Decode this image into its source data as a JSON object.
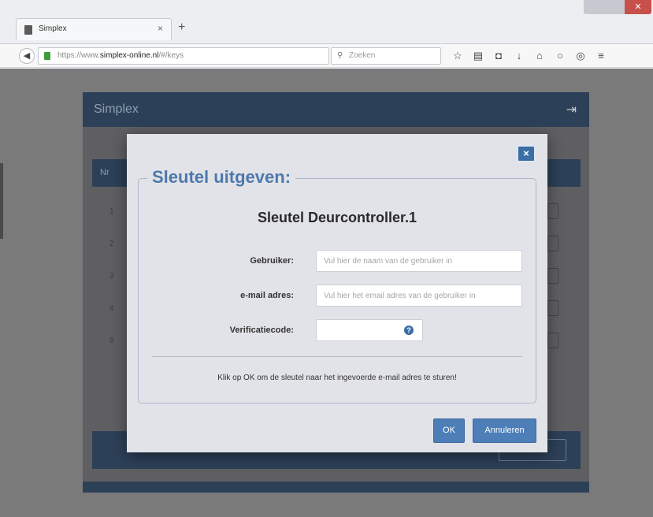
{
  "browser": {
    "tab_title": "Simplex",
    "tab_close": "×",
    "new_tab": "+",
    "window_close": "✕",
    "url_prefix": "https://www.",
    "url_domain": "simplex-online.nl",
    "url_path": "/#/keys",
    "search_placeholder": "Zoeken",
    "icons": [
      "back-icon",
      "lock-icon",
      "reload-icon",
      "search-icon",
      "bookmark-star-icon",
      "reading-list-icon",
      "pocket-icon",
      "download-icon",
      "home-icon",
      "chat-icon",
      "extension-icon",
      "menu-icon"
    ]
  },
  "app": {
    "title": "Simplex",
    "logout_icon": "logout-icon",
    "table": {
      "column_nr": "Nr",
      "row_numbers": [
        "1",
        "2",
        "3",
        "4",
        "5"
      ]
    }
  },
  "modal": {
    "legend": "Sleutel uitgeven:",
    "key_title": "Sleutel Deurcontroller.1",
    "close_label": "×",
    "fields": {
      "user_label": "Gebruiker:",
      "user_placeholder": "Vul hier de naam van de gebruiker in",
      "user_value": "",
      "email_label": "e-mail adres:",
      "email_placeholder": "Vul hier het email adres van de gebruiker in",
      "email_value": "",
      "code_label": "Verificatiecode:",
      "code_value": ""
    },
    "help_glyph": "?",
    "info_text": "Klik op OK om de sleutel naar het ingevoerde e-mail adres te sturen!",
    "ok_label": "OK",
    "cancel_label": "Annuleren"
  },
  "colors": {
    "accent": "#4d7eb8",
    "header": "#2c4057",
    "legend": "#4d79ad",
    "overlay": "#7a7a7a"
  }
}
